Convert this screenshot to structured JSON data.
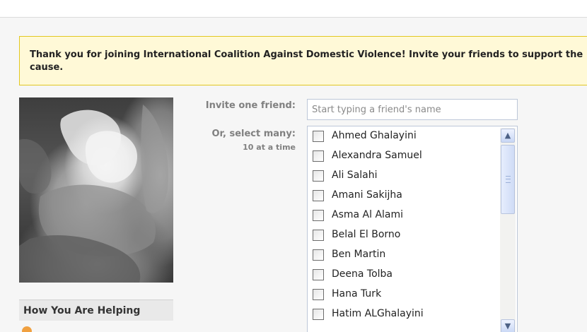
{
  "notice": {
    "message": "Thank you for joining International Coalition Against Domestic Violence! Invite your friends to support the cause."
  },
  "sidebar": {
    "photo_icon": "hands-photo",
    "helping_title": "How You Are Helping"
  },
  "invite": {
    "one_friend_label": "Invite one friend:",
    "search_placeholder": "Start typing a friend's name",
    "select_many_label": "Or, select many:",
    "limit_label": "10 at a time",
    "friends": [
      {
        "name": "Ahmed Ghalayini",
        "checked": false
      },
      {
        "name": "Alexandra Samuel",
        "checked": false
      },
      {
        "name": "Ali Salahi",
        "checked": false
      },
      {
        "name": "Amani Sakijha",
        "checked": false
      },
      {
        "name": "Asma Al Alami",
        "checked": false
      },
      {
        "name": "Belal El Borno",
        "checked": false
      },
      {
        "name": "Ben Martin",
        "checked": false
      },
      {
        "name": "Deena Tolba",
        "checked": false
      },
      {
        "name": "Hana Turk",
        "checked": false
      },
      {
        "name": "Hatim ALGhalayini",
        "checked": false
      }
    ]
  },
  "scrollbar": {
    "up_icon": "arrow-up-icon",
    "down_icon": "arrow-down-icon"
  },
  "colors": {
    "notice_bg": "#fff9d7",
    "notice_border": "#e2c822",
    "label_gray": "#808080",
    "input_border": "#bdc7d8"
  }
}
